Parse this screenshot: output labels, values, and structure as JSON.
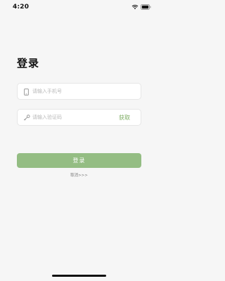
{
  "status_bar": {
    "time": "4:20"
  },
  "page": {
    "title": "登录"
  },
  "phone_field": {
    "icon": "phone-icon",
    "placeholder": "请输入手机号",
    "value": ""
  },
  "code_field": {
    "icon": "key-icon",
    "placeholder": "请输入验证码",
    "value": "",
    "get_code_label": "获取"
  },
  "login_button": {
    "label": "登录"
  },
  "cancel_link": {
    "label": "取消>>>"
  },
  "colors": {
    "accent": "#94bd83",
    "accent_text": "#7fae65",
    "background": "#f6f6f6"
  }
}
